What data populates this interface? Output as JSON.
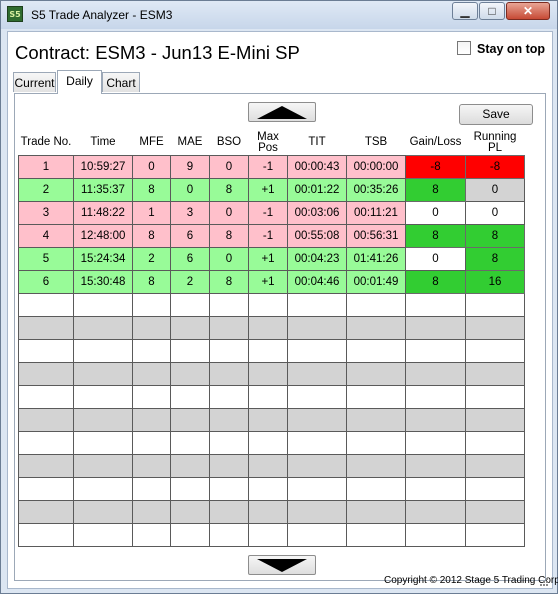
{
  "window": {
    "title": "S5 Trade Analyzer - ESM3",
    "icon_label": "S5"
  },
  "header": {
    "contract_label": "Contract: ESM3 - Jun13 E-Mini SP",
    "stay_on_top_label": "Stay on top",
    "stay_on_top_checked": false
  },
  "tabs": [
    {
      "label": "Current"
    },
    {
      "label": "Daily"
    },
    {
      "label": "Chart"
    }
  ],
  "active_tab": "Daily",
  "toolbar": {
    "save_label": "Save",
    "scroll_up": "up-arrow-icon",
    "scroll_down": "down-arrow-icon"
  },
  "colors": {
    "loss_row": "#ffc0cb",
    "win_row": "#98fb98",
    "loss_cell": "#ff0000",
    "win_cell": "#32cd32",
    "even_cell": "#ffffff",
    "flat_cell": "#d3d3d3",
    "empty_alt": "#d3d3d3"
  },
  "table": {
    "columns": [
      "Trade No.",
      "Time",
      "MFE",
      "MAE",
      "BSO",
      "Max Pos",
      "TIT",
      "TSB",
      "Gain/Loss",
      "Running PL"
    ],
    "rows": [
      {
        "cells": [
          "1",
          "10:59:27",
          "0",
          "9",
          "0",
          "-1",
          "00:00:43",
          "00:00:00",
          "-8",
          "-8"
        ],
        "row_color": "#ffc0cb",
        "gain_color": "#ff0000",
        "pl_color": "#ff0000"
      },
      {
        "cells": [
          "2",
          "11:35:37",
          "8",
          "0",
          "8",
          "+1",
          "00:01:22",
          "00:35:26",
          "8",
          "0"
        ],
        "row_color": "#98fb98",
        "gain_color": "#32cd32",
        "pl_color": "#d3d3d3"
      },
      {
        "cells": [
          "3",
          "11:48:22",
          "1",
          "3",
          "0",
          "-1",
          "00:03:06",
          "00:11:21",
          "0",
          "0"
        ],
        "row_color": "#ffc0cb",
        "gain_color": "#ffffff",
        "pl_color": "#ffffff"
      },
      {
        "cells": [
          "4",
          "12:48:00",
          "8",
          "6",
          "8",
          "-1",
          "00:55:08",
          "00:56:31",
          "8",
          "8"
        ],
        "row_color": "#ffc0cb",
        "gain_color": "#32cd32",
        "pl_color": "#32cd32"
      },
      {
        "cells": [
          "5",
          "15:24:34",
          "2",
          "6",
          "0",
          "+1",
          "00:04:23",
          "01:41:26",
          "0",
          "8"
        ],
        "row_color": "#98fb98",
        "gain_color": "#ffffff",
        "pl_color": "#32cd32"
      },
      {
        "cells": [
          "6",
          "15:30:48",
          "8",
          "2",
          "8",
          "+1",
          "00:04:46",
          "00:01:49",
          "8",
          "16"
        ],
        "row_color": "#98fb98",
        "gain_color": "#32cd32",
        "pl_color": "#32cd32"
      }
    ],
    "empty_rows": 11
  },
  "footer": {
    "copyright": "Copyright © 2012 Stage 5 Trading Corp."
  }
}
